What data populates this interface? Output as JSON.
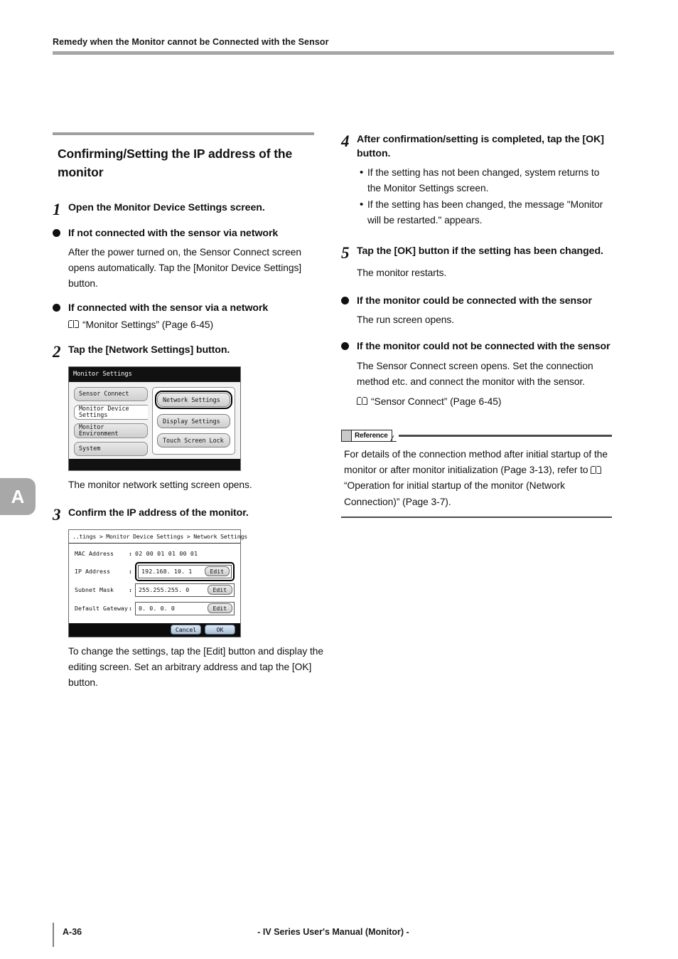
{
  "header": {
    "running_head": "Remedy when the Monitor cannot be Connected with the Sensor"
  },
  "side_tab": {
    "label": "A"
  },
  "left_column": {
    "section_title": "Confirming/Setting the IP address of the monitor",
    "step1": {
      "number": "1",
      "text": "Open the Monitor Device Settings screen.",
      "bullet1_head": "If not connected with the sensor via network",
      "bullet1_body": "After the power turned on, the Sensor Connect screen opens automatically. Tap the [Monitor Device Settings] button.",
      "bullet2_head": "If connected with the sensor via a network",
      "bullet2_xref": "“Monitor Settings” (Page 6-45)"
    },
    "step2": {
      "number": "2",
      "text": "Tap the [Network Settings] button.",
      "caption": "The monitor network setting screen opens."
    },
    "step3": {
      "number": "3",
      "text": "Confirm the IP address of the monitor.",
      "caption": "To change the settings, tap the [Edit] button and display the editing screen. Set an arbitrary address and tap the [OK] button."
    }
  },
  "monitor_settings_screen": {
    "title": "Monitor Settings",
    "tabs": [
      {
        "label": "Sensor Connect",
        "selected": false
      },
      {
        "label": "Monitor Device Settings",
        "selected": true
      },
      {
        "label": "Monitor Environment",
        "selected": false
      },
      {
        "label": "System",
        "selected": false
      }
    ],
    "buttons": [
      {
        "label": "Network Settings",
        "highlighted": true
      },
      {
        "label": "Display Settings",
        "highlighted": false
      },
      {
        "label": "Touch Screen Lock",
        "highlighted": false
      }
    ]
  },
  "network_settings_screen": {
    "breadcrumb": "..tings > Monitor Device Settings > Network Settings",
    "rows": [
      {
        "label": "MAC Address",
        "colon": ":",
        "value": "02 00 01 01 00 01",
        "editable": false,
        "highlighted": false
      },
      {
        "label": "IP Address",
        "colon": ":",
        "value": "192.168. 10.  1",
        "edit_label": "Edit",
        "editable": true,
        "highlighted": true
      },
      {
        "label": "Subnet Mask",
        "colon": ":",
        "value": "255.255.255.  0",
        "edit_label": "Edit",
        "editable": true,
        "highlighted": false
      },
      {
        "label": "Default Gateway",
        "colon": ":",
        "value": " 0.  0.  0.  0",
        "edit_label": "Edit",
        "editable": true,
        "highlighted": false
      }
    ],
    "footer_buttons": [
      {
        "label": "Cancel"
      },
      {
        "label": "OK"
      }
    ]
  },
  "right_column": {
    "step4": {
      "number": "4",
      "text": "After confirmation/setting is completed, tap the [OK] button.",
      "bullets": [
        "If the setting has not been changed, system returns to the Monitor Settings screen.",
        "If the setting has been changed, the message \"Monitor will be restarted.\" appears."
      ]
    },
    "step5": {
      "number": "5",
      "text": "Tap the [OK] button if the setting has been changed.",
      "caption": "The monitor restarts."
    },
    "bullet1_head": "If the monitor could be connected with the sensor",
    "bullet1_body": "The run screen opens.",
    "bullet2_head": "If the monitor could not be connected with the sensor",
    "bullet2_body": "The Sensor Connect screen opens. Set the connection method etc. and connect the monitor with the sensor.",
    "bullet2_xref": "“Sensor Connect” (Page 6-45)",
    "reference": {
      "tag_label": "Reference",
      "body_part1": "For details of the connection method after initial startup of the monitor or after monitor initialization (Page 3-13), refer to ",
      "body_part2": "“Operation for initial startup of the monitor (Network Connection)” (Page 3-7)."
    }
  },
  "footer": {
    "page_number": "A-36",
    "manual_title": "- IV Series User's Manual (Monitor) -"
  }
}
